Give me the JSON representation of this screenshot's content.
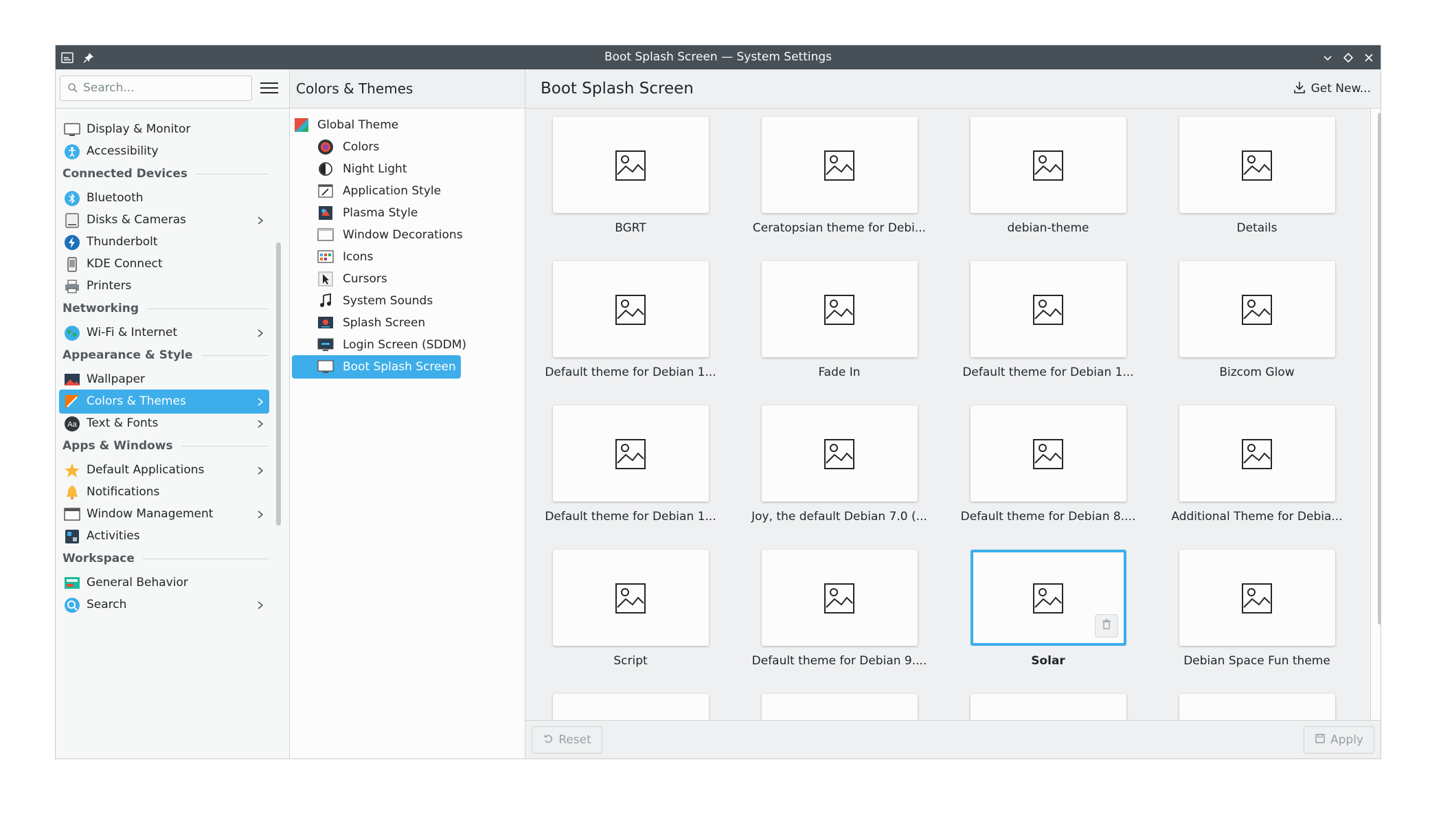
{
  "window": {
    "title": "Boot Splash Screen — System Settings"
  },
  "sidebar": {
    "search_placeholder": "Search...",
    "items": [
      {
        "type": "item",
        "label": "Display & Monitor",
        "icon": "monitor-icon",
        "chevron": false,
        "active": false
      },
      {
        "type": "item",
        "label": "Accessibility",
        "icon": "accessibility-icon",
        "chevron": false,
        "active": false
      },
      {
        "type": "header",
        "label": "Connected Devices"
      },
      {
        "type": "item",
        "label": "Bluetooth",
        "icon": "bluetooth-icon",
        "chevron": false,
        "active": false
      },
      {
        "type": "item",
        "label": "Disks & Cameras",
        "icon": "disk-icon",
        "chevron": true,
        "active": false
      },
      {
        "type": "item",
        "label": "Thunderbolt",
        "icon": "thunderbolt-icon",
        "chevron": false,
        "active": false
      },
      {
        "type": "item",
        "label": "KDE Connect",
        "icon": "phone-icon",
        "chevron": false,
        "active": false
      },
      {
        "type": "item",
        "label": "Printers",
        "icon": "printer-icon",
        "chevron": false,
        "active": false
      },
      {
        "type": "header",
        "label": "Networking"
      },
      {
        "type": "item",
        "label": "Wi-Fi & Internet",
        "icon": "globe-icon",
        "chevron": true,
        "active": false
      },
      {
        "type": "header",
        "label": "Appearance & Style"
      },
      {
        "type": "item",
        "label": "Wallpaper",
        "icon": "wallpaper-icon",
        "chevron": false,
        "active": false
      },
      {
        "type": "item",
        "label": "Colors & Themes",
        "icon": "palette-icon",
        "chevron": true,
        "active": true
      },
      {
        "type": "item",
        "label": "Text & Fonts",
        "icon": "font-icon",
        "chevron": true,
        "active": false
      },
      {
        "type": "header",
        "label": "Apps & Windows"
      },
      {
        "type": "item",
        "label": "Default Applications",
        "icon": "star-icon",
        "chevron": true,
        "active": false
      },
      {
        "type": "item",
        "label": "Notifications",
        "icon": "bell-icon",
        "chevron": false,
        "active": false
      },
      {
        "type": "item",
        "label": "Window Management",
        "icon": "window-icon",
        "chevron": true,
        "active": false
      },
      {
        "type": "item",
        "label": "Activities",
        "icon": "activities-icon",
        "chevron": false,
        "active": false
      },
      {
        "type": "header",
        "label": "Workspace"
      },
      {
        "type": "item",
        "label": "General Behavior",
        "icon": "behavior-icon",
        "chevron": false,
        "active": false
      },
      {
        "type": "item",
        "label": "Search",
        "icon": "search-icon",
        "chevron": true,
        "active": false
      }
    ]
  },
  "middle": {
    "title": "Colors & Themes",
    "items": [
      {
        "label": "Global Theme",
        "icon": "global-theme-icon",
        "indent": false,
        "active": false
      },
      {
        "label": "Colors",
        "icon": "colors-icon",
        "indent": true,
        "active": false
      },
      {
        "label": "Night Light",
        "icon": "night-light-icon",
        "indent": true,
        "active": false
      },
      {
        "label": "Application Style",
        "icon": "application-style-icon",
        "indent": true,
        "active": false
      },
      {
        "label": "Plasma Style",
        "icon": "plasma-style-icon",
        "indent": true,
        "active": false
      },
      {
        "label": "Window Decorations",
        "icon": "window-decorations-icon",
        "indent": true,
        "active": false
      },
      {
        "label": "Icons",
        "icon": "icons-icon",
        "indent": true,
        "active": false
      },
      {
        "label": "Cursors",
        "icon": "cursor-icon",
        "indent": true,
        "active": false
      },
      {
        "label": "System Sounds",
        "icon": "music-note-icon",
        "indent": true,
        "active": false
      },
      {
        "label": "Splash Screen",
        "icon": "splash-screen-icon",
        "indent": true,
        "active": false
      },
      {
        "label": "Login Screen (SDDM)",
        "icon": "login-screen-icon",
        "indent": true,
        "active": false
      },
      {
        "label": "Boot Splash Screen",
        "icon": "boot-splash-icon",
        "indent": true,
        "active": true
      }
    ]
  },
  "content": {
    "title": "Boot Splash Screen",
    "get_new_label": "Get New...",
    "themes": [
      {
        "label": "BGRT",
        "selected": false
      },
      {
        "label": "Ceratopsian theme for Debi...",
        "selected": false
      },
      {
        "label": "debian-theme",
        "selected": false
      },
      {
        "label": "Details",
        "selected": false
      },
      {
        "label": "Default theme for Debian 1...",
        "selected": false
      },
      {
        "label": "Fade In",
        "selected": false
      },
      {
        "label": "Default theme for Debian 1...",
        "selected": false
      },
      {
        "label": "Bizcom Glow",
        "selected": false
      },
      {
        "label": "Default theme for Debian 1...",
        "selected": false
      },
      {
        "label": "Joy, the default Debian 7.0 (...",
        "selected": false
      },
      {
        "label": "Default theme for Debian 8....",
        "selected": false
      },
      {
        "label": "Additional Theme for Debia...",
        "selected": false
      },
      {
        "label": "Script",
        "selected": false
      },
      {
        "label": "Default theme for Debian 9....",
        "selected": false
      },
      {
        "label": "Solar",
        "selected": true
      },
      {
        "label": "Debian Space Fun theme",
        "selected": false
      },
      {
        "label": "",
        "selected": false
      },
      {
        "label": "",
        "selected": false
      },
      {
        "label": "",
        "selected": false
      },
      {
        "label": "",
        "selected": false
      }
    ],
    "reset_label": "Reset",
    "apply_label": "Apply"
  }
}
